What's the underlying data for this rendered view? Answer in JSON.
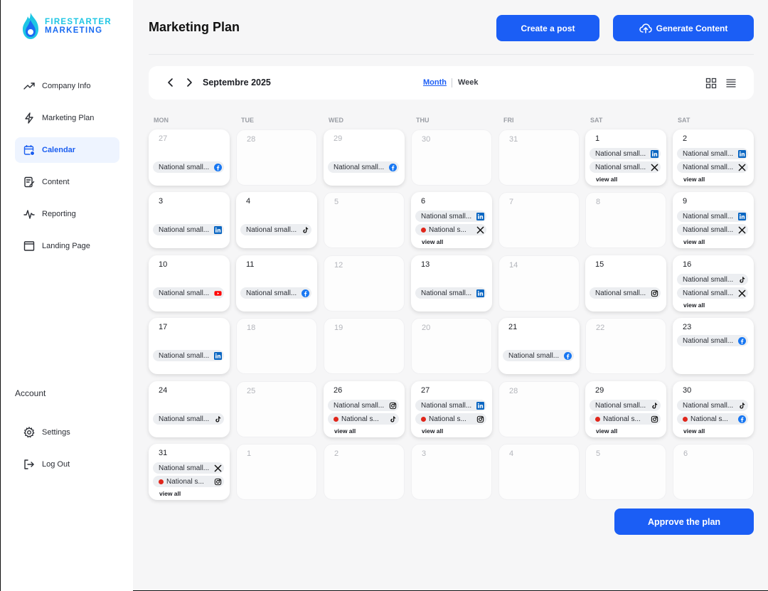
{
  "brand": {
    "line1": "FIRESTARTER",
    "line2": "MARKETING"
  },
  "sidebar": {
    "items": [
      {
        "label": "Company Info",
        "icon": "trending-up-icon"
      },
      {
        "label": "Marketing Plan",
        "icon": "lightning-icon"
      },
      {
        "label": "Calendar",
        "icon": "calendar-icon",
        "active": true
      },
      {
        "label": "Content",
        "icon": "content-icon"
      },
      {
        "label": "Reporting",
        "icon": "pulse-icon"
      },
      {
        "label": "Landing Page",
        "icon": "window-icon"
      }
    ],
    "account_label": "Account",
    "account_items": [
      {
        "label": "Settings",
        "icon": "gear-icon"
      },
      {
        "label": "Log Out",
        "icon": "logout-icon"
      }
    ]
  },
  "header": {
    "title": "Marketing Plan",
    "create_label": "Create a post",
    "generate_label": "Generate Content"
  },
  "calendar": {
    "month_title": "Septembre 2025",
    "view_month": "Month",
    "view_week": "Week",
    "weekdays": [
      "MON",
      "TUE",
      "WED",
      "THU",
      "FRI",
      "SAT",
      "SAT"
    ],
    "view_all_label": "view all",
    "chip_text": "National small...",
    "chip_text_short": "National s...",
    "colors": {
      "accent": "#1b5ef5",
      "facebook": "#1877f2",
      "linkedin": "#0a66c2",
      "youtube": "#ff0000",
      "alert_dot": "#e0261b"
    },
    "weeks": [
      [
        {
          "day": "27",
          "dim": true,
          "events": [
            {
              "icon": "facebook"
            }
          ]
        },
        {
          "day": "28",
          "dim": true,
          "events": []
        },
        {
          "day": "29",
          "dim": true,
          "events": [
            {
              "icon": "facebook"
            }
          ]
        },
        {
          "day": "30",
          "dim": true,
          "events": []
        },
        {
          "day": "31",
          "dim": true,
          "events": []
        },
        {
          "day": "1",
          "events": [
            {
              "icon": "linkedin"
            },
            {
              "icon": "x"
            }
          ],
          "more": true
        },
        {
          "day": "2",
          "events": [
            {
              "icon": "linkedin"
            },
            {
              "icon": "x"
            }
          ],
          "more": true
        }
      ],
      [
        {
          "day": "3",
          "events": [
            {
              "icon": "linkedin"
            }
          ]
        },
        {
          "day": "4",
          "events": [
            {
              "icon": "tiktok"
            }
          ]
        },
        {
          "day": "5",
          "dim": true,
          "events": []
        },
        {
          "day": "6",
          "events": [
            {
              "icon": "linkedin"
            },
            {
              "icon": "x",
              "alert": true
            }
          ],
          "more": true
        },
        {
          "day": "7",
          "dim": true,
          "events": []
        },
        {
          "day": "8",
          "dim": true,
          "events": []
        },
        {
          "day": "9",
          "events": [
            {
              "icon": "linkedin"
            },
            {
              "icon": "x"
            }
          ],
          "more": true
        }
      ],
      [
        {
          "day": "10",
          "events": [
            {
              "icon": "youtube"
            }
          ]
        },
        {
          "day": "11",
          "events": [
            {
              "icon": "facebook"
            }
          ]
        },
        {
          "day": "12",
          "dim": true,
          "events": []
        },
        {
          "day": "13",
          "events": [
            {
              "icon": "linkedin"
            }
          ]
        },
        {
          "day": "14",
          "dim": true,
          "events": []
        },
        {
          "day": "15",
          "events": [
            {
              "icon": "instagram"
            }
          ]
        },
        {
          "day": "16",
          "events": [
            {
              "icon": "tiktok"
            },
            {
              "icon": "x"
            }
          ],
          "more": true
        }
      ],
      [
        {
          "day": "17",
          "events": [
            {
              "icon": "linkedin"
            }
          ]
        },
        {
          "day": "18",
          "dim": true,
          "events": []
        },
        {
          "day": "19",
          "dim": true,
          "events": []
        },
        {
          "day": "20",
          "dim": true,
          "events": []
        },
        {
          "day": "21",
          "events": [
            {
              "icon": "facebook"
            }
          ]
        },
        {
          "day": "22",
          "dim": true,
          "events": []
        },
        {
          "day": "23",
          "events": [
            {
              "icon": "facebook"
            }
          ],
          "top": true
        }
      ],
      [
        {
          "day": "24",
          "events": [
            {
              "icon": "tiktok"
            }
          ]
        },
        {
          "day": "25",
          "dim": true,
          "events": []
        },
        {
          "day": "26",
          "events": [
            {
              "icon": "instagram"
            },
            {
              "icon": "tiktok",
              "alert": true
            }
          ],
          "more": true
        },
        {
          "day": "27",
          "events": [
            {
              "icon": "linkedin"
            },
            {
              "icon": "instagram",
              "alert": true
            }
          ],
          "more": true
        },
        {
          "day": "28",
          "dim": true,
          "events": []
        },
        {
          "day": "29",
          "events": [
            {
              "icon": "tiktok"
            },
            {
              "icon": "instagram",
              "alert": true
            }
          ],
          "more": true
        },
        {
          "day": "30",
          "events": [
            {
              "icon": "tiktok"
            },
            {
              "icon": "facebook",
              "alert": true
            }
          ],
          "more": true
        }
      ],
      [
        {
          "day": "31",
          "events": [
            {
              "icon": "x"
            },
            {
              "icon": "instagram",
              "alert": true
            }
          ],
          "more": true
        },
        {
          "day": "1",
          "dim": true,
          "events": []
        },
        {
          "day": "2",
          "dim": true,
          "events": []
        },
        {
          "day": "3",
          "dim": true,
          "events": []
        },
        {
          "day": "4",
          "dim": true,
          "events": []
        },
        {
          "day": "5",
          "dim": true,
          "events": []
        },
        {
          "day": "6",
          "dim": true,
          "events": []
        }
      ]
    ],
    "approve_label": "Approve the plan"
  }
}
